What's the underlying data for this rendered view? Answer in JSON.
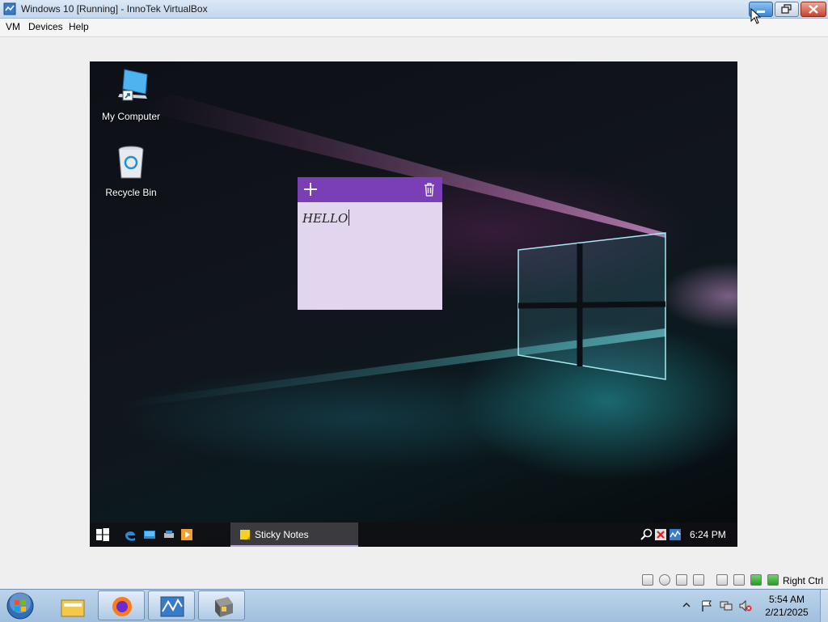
{
  "window": {
    "title": "Windows 10 [Running] - InnoTek VirtualBox",
    "controls": [
      "minimize",
      "restore",
      "close"
    ]
  },
  "menu": {
    "items": [
      {
        "label": "VM"
      },
      {
        "label": "Devices"
      },
      {
        "label": "Help"
      }
    ]
  },
  "guest": {
    "desktop_icons": [
      {
        "label": "My Computer",
        "icon": "computer-icon"
      },
      {
        "label": "Recycle Bin",
        "icon": "recycle-bin-icon"
      }
    ],
    "sticky_note": {
      "text": "HELLO",
      "header_color": "#7a3fb5",
      "body_color": "#e1d6ee"
    },
    "taskbar": {
      "pinned_icons": [
        "start-icon",
        "edge-icon",
        "desktop-icon",
        "network-icon",
        "media-icon"
      ],
      "active_app": "Sticky Notes",
      "tray_icons": [
        "magnifier-icon",
        "network-error-icon",
        "monitor-icon"
      ],
      "clock": "6:24 PM"
    }
  },
  "statusbar": {
    "icons": [
      "hard-disk-icon",
      "cd-icon",
      "floppy-icon",
      "network-icon",
      "usb-icon",
      "shared-folder-icon",
      "capture-icon",
      "mouse-integration-icon"
    ],
    "host_key": "Right Ctrl"
  },
  "host_taskbar": {
    "apps": [
      "explorer-icon",
      "firefox-icon",
      "monitor-app-icon",
      "virtualbox-icon"
    ],
    "clock_time": "5:54 AM",
    "clock_date": "2/21/2025"
  }
}
